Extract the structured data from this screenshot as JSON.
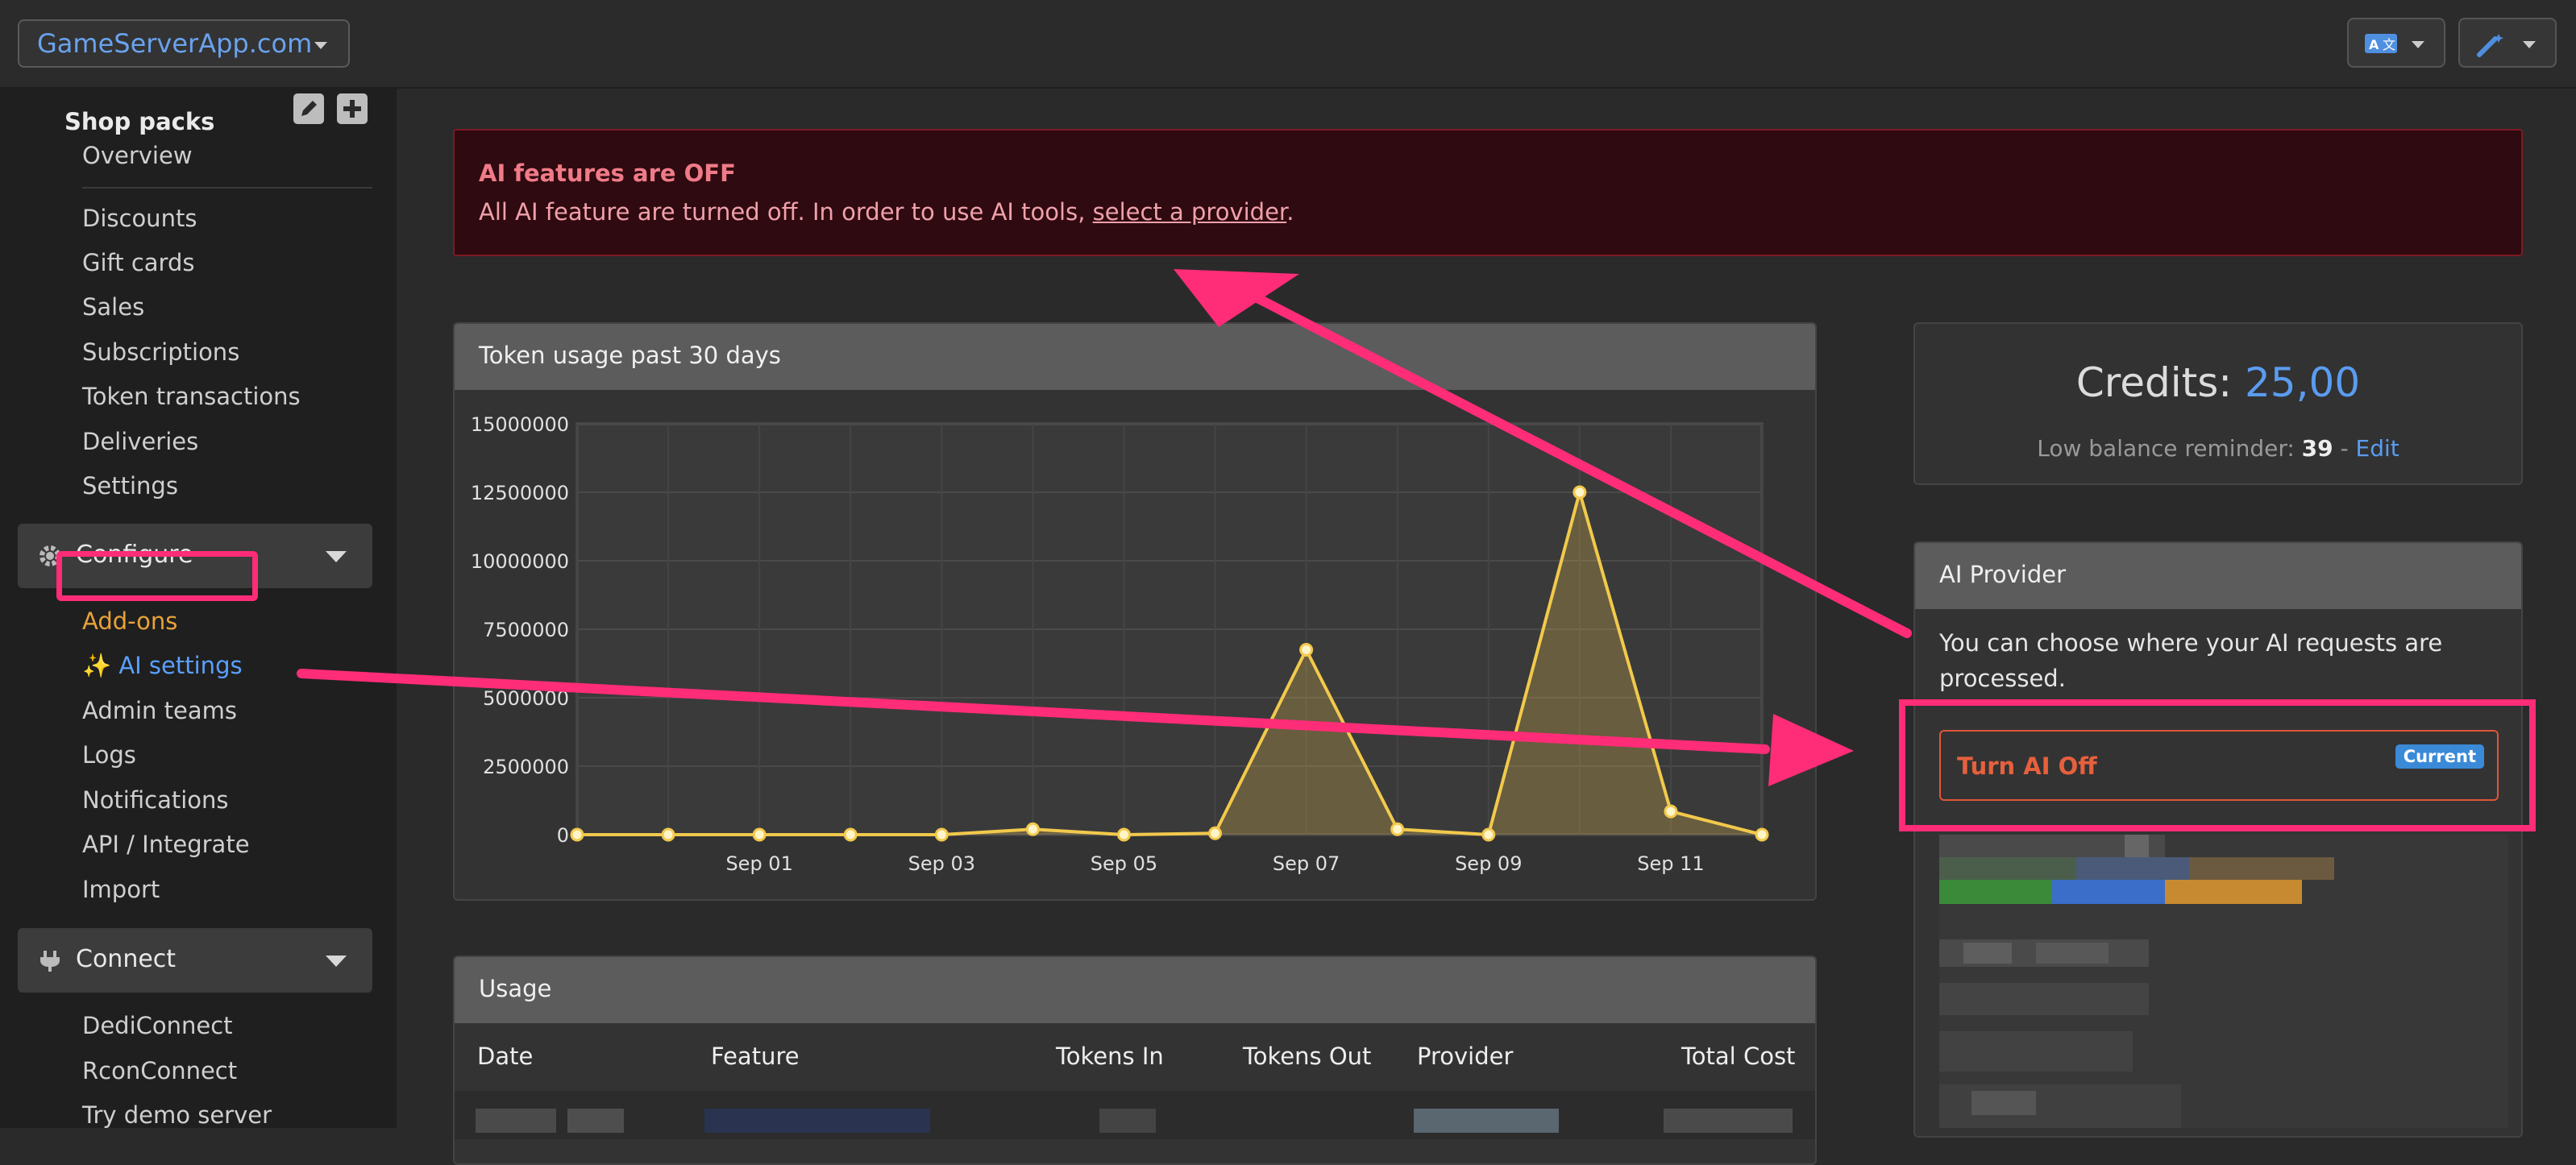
{
  "topbar": {
    "site_name": "GameServerApp.com"
  },
  "sidebar": {
    "shop_packs_title": "Shop packs",
    "shop_items": [
      "Overview",
      "Discounts",
      "Gift cards",
      "Sales",
      "Subscriptions",
      "Token transactions",
      "Deliveries",
      "Settings"
    ],
    "configure_label": "Configure",
    "configure_items": [
      "Add-ons",
      "✨ AI settings",
      "Admin teams",
      "Logs",
      "Notifications",
      "API / Integrate",
      "Import"
    ],
    "connect_label": "Connect",
    "connect_items": [
      "DediConnect",
      "RconConnect",
      "Try demo server"
    ]
  },
  "alert": {
    "title": "AI features are OFF",
    "text_before": "All AI feature are turned off. In order to use AI tools, ",
    "link": "select a provider",
    "text_after": "."
  },
  "chart_panel": {
    "title": "Token usage past 30 days"
  },
  "chart_data": {
    "type": "area",
    "title": "Token usage past 30 days",
    "x": [
      "Aug 30",
      "Aug 31",
      "Sep 01",
      "Sep 02",
      "Sep 03",
      "Sep 04",
      "Sep 05",
      "Sep 06",
      "Sep 07",
      "Sep 08",
      "Sep 09",
      "Sep 10",
      "Sep 11",
      "Sep 12"
    ],
    "x_tick_labels": [
      "Sep 01",
      "Sep 03",
      "Sep 05",
      "Sep 07",
      "Sep 09",
      "Sep 11"
    ],
    "values": [
      0,
      0,
      0,
      0,
      0,
      200000,
      0,
      50000,
      6750000,
      200000,
      0,
      12500000,
      850000,
      0
    ],
    "y_ticks": [
      "0",
      "2500000",
      "5000000",
      "7500000",
      "10000000",
      "12500000",
      "15000000"
    ],
    "ylim": [
      0,
      15000000
    ],
    "grid": true,
    "color": "#f2c94c"
  },
  "credits": {
    "label": "Credits: ",
    "value": "25,00",
    "reminder_label": "Low balance reminder: ",
    "reminder_value": "39",
    "separator": " - ",
    "edit_label": "Edit"
  },
  "ai_provider": {
    "title": "AI Provider",
    "description": "You can choose where your AI requests are processed.",
    "turn_off_label": "Turn AI Off",
    "current_badge": "Current"
  },
  "usage": {
    "title": "Usage",
    "columns": [
      "Date",
      "Feature",
      "Tokens In",
      "Tokens Out",
      "Provider",
      "Total Cost"
    ]
  }
}
